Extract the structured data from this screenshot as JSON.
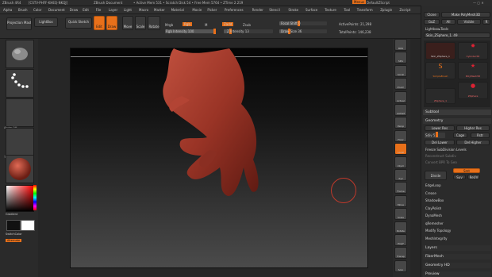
{
  "titlebar": {
    "app": "ZBrush 4R4",
    "info": "[CSTV-PHFF-KHEQ-NKQJ]",
    "doc": "ZBrush Document",
    "mem": "• Active Mem 531 • Scratch Disk 54 • Free Mem 5764 • ZTime 2.219",
    "menus_btn": "Menus",
    "script": "DefaultZScript"
  },
  "menu": [
    "Alpha",
    "Brush",
    "Color",
    "Document",
    "Draw",
    "Edit",
    "File",
    "Layer",
    "Light",
    "Macro",
    "Marker",
    "Material",
    "Movie",
    "Picker",
    "Preferences",
    "Render",
    "Stencil",
    "Stroke",
    "Surface",
    "Texture",
    "Tool",
    "Transform",
    "Zplugin",
    "Zscript"
  ],
  "shelf": {
    "projection_master": "Projection Master",
    "lightbox": "LightBox",
    "quick_sketch": "Quick Sketch",
    "edit": "Edit",
    "draw": "Draw",
    "move": "Move",
    "scale": "Scale",
    "rotate": "Rotate",
    "mrgb": "Mrgb",
    "rgb": "Rgb",
    "m": "M",
    "rgb_intensity": "Rgb Intensity 100",
    "zadd": "Zadd",
    "zsub": "Zsub",
    "zintensity": "Z Intensity 13",
    "focal_shift": "Focal Shift 0",
    "draw_size": "Draw Size 36",
    "active_points": "ActivePoints: 21,298",
    "total_points": "TotalPoints: 146,238",
    "focal_pct": 0.4,
    "draw_pct": 0.2,
    "rgb_pct": 1.0,
    "z_pct": 0.13
  },
  "left": {
    "brush": "Clay",
    "stroke": "Dots",
    "alpha": "Alpha Off",
    "texture": "Texture Off",
    "material": "SkinShade4",
    "gradient": "Gradient",
    "switch": "SwitchColor",
    "alternate": "Alternate"
  },
  "rtools": [
    "BPR",
    "SPix",
    "Scroll",
    "Zoom",
    "Actual",
    "AAHalf",
    "Persp",
    "Floor",
    "Local",
    "LSym",
    "Xyz",
    "Frame",
    "Move",
    "Scale",
    "Rotate",
    "PolyF",
    "Transp",
    "Solo"
  ],
  "panel": {
    "tool_buttons": [
      "Clone",
      "Make PolyMesh3D",
      "GoZ",
      "All",
      "Visible",
      "R"
    ],
    "lightbox_tools": "Lightbox▸Tools",
    "current_tool": "Skin_ZSphere_1. 49",
    "tools": [
      "Skin_ZSphere_1",
      "Cylinder3D",
      "PolyMesh3D",
      "SimpleBrush",
      "ZSphere",
      "ZSphere_1"
    ],
    "subtool": "Subtool",
    "geometry": "Geometry",
    "geo_buttons": [
      "Lower Res",
      "Higher Res",
      "Sdiv 5",
      "Cage",
      "Rstr",
      "Del Lower",
      "Del Higher"
    ],
    "freeze": "Freeze SubDivision Levels",
    "reconstruct": "Reconstruct Subdiv",
    "convert": "Convert BPR To Geo",
    "divide": "Divide",
    "smt": "Smt",
    "suv": "Suv",
    "reuv": "ReUV",
    "items": [
      "EdgeLoop",
      "Crease",
      "ShadowBox",
      "ClayPolish",
      "DynaMesh",
      "qRemesher",
      "Modify Topology",
      "MeshIntegrity"
    ],
    "sections": [
      "Layers",
      "FiberMesh",
      "Geometry HD",
      "Preview"
    ]
  },
  "colors": {
    "accent": "#e8701a",
    "model": "#9e3a2c"
  }
}
